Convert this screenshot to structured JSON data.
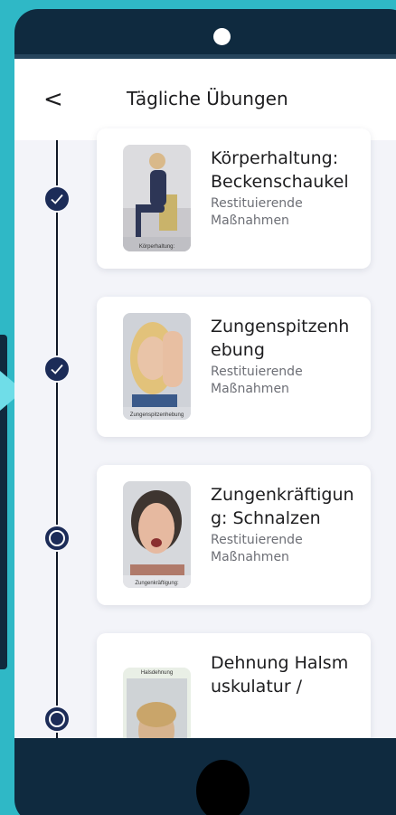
{
  "header": {
    "back_label": "<",
    "title": "Tägliche Übungen"
  },
  "exercises": [
    {
      "title": "Körperhaltung: Beckenschaukel",
      "subtitle": "Restituierende Maßnahmen",
      "thumb_caption": "Körperhaltung:",
      "status": "completed"
    },
    {
      "title": "Zungenspitzenhebung",
      "subtitle": "Restituierende Maßnahmen",
      "thumb_caption": "Zungenspitzenhebung",
      "status": "completed"
    },
    {
      "title": "Zungenkräftigung: Schnalzen",
      "subtitle": "Restituierende Maßnahmen",
      "thumb_caption": "Zungenkräftigung:",
      "status": "open"
    },
    {
      "title": "Dehnung Halsmuskulatur /",
      "subtitle": "",
      "thumb_caption": "Halsdehnung",
      "status": "open"
    }
  ],
  "colors": {
    "background": "#2fb8c6",
    "device": "#0f2a3f",
    "node": "#1c2c58",
    "title_text": "#1d1d1f",
    "subtitle_text": "#6d6f76"
  },
  "icons": {
    "completed": "check-icon",
    "open": "ring-icon"
  }
}
